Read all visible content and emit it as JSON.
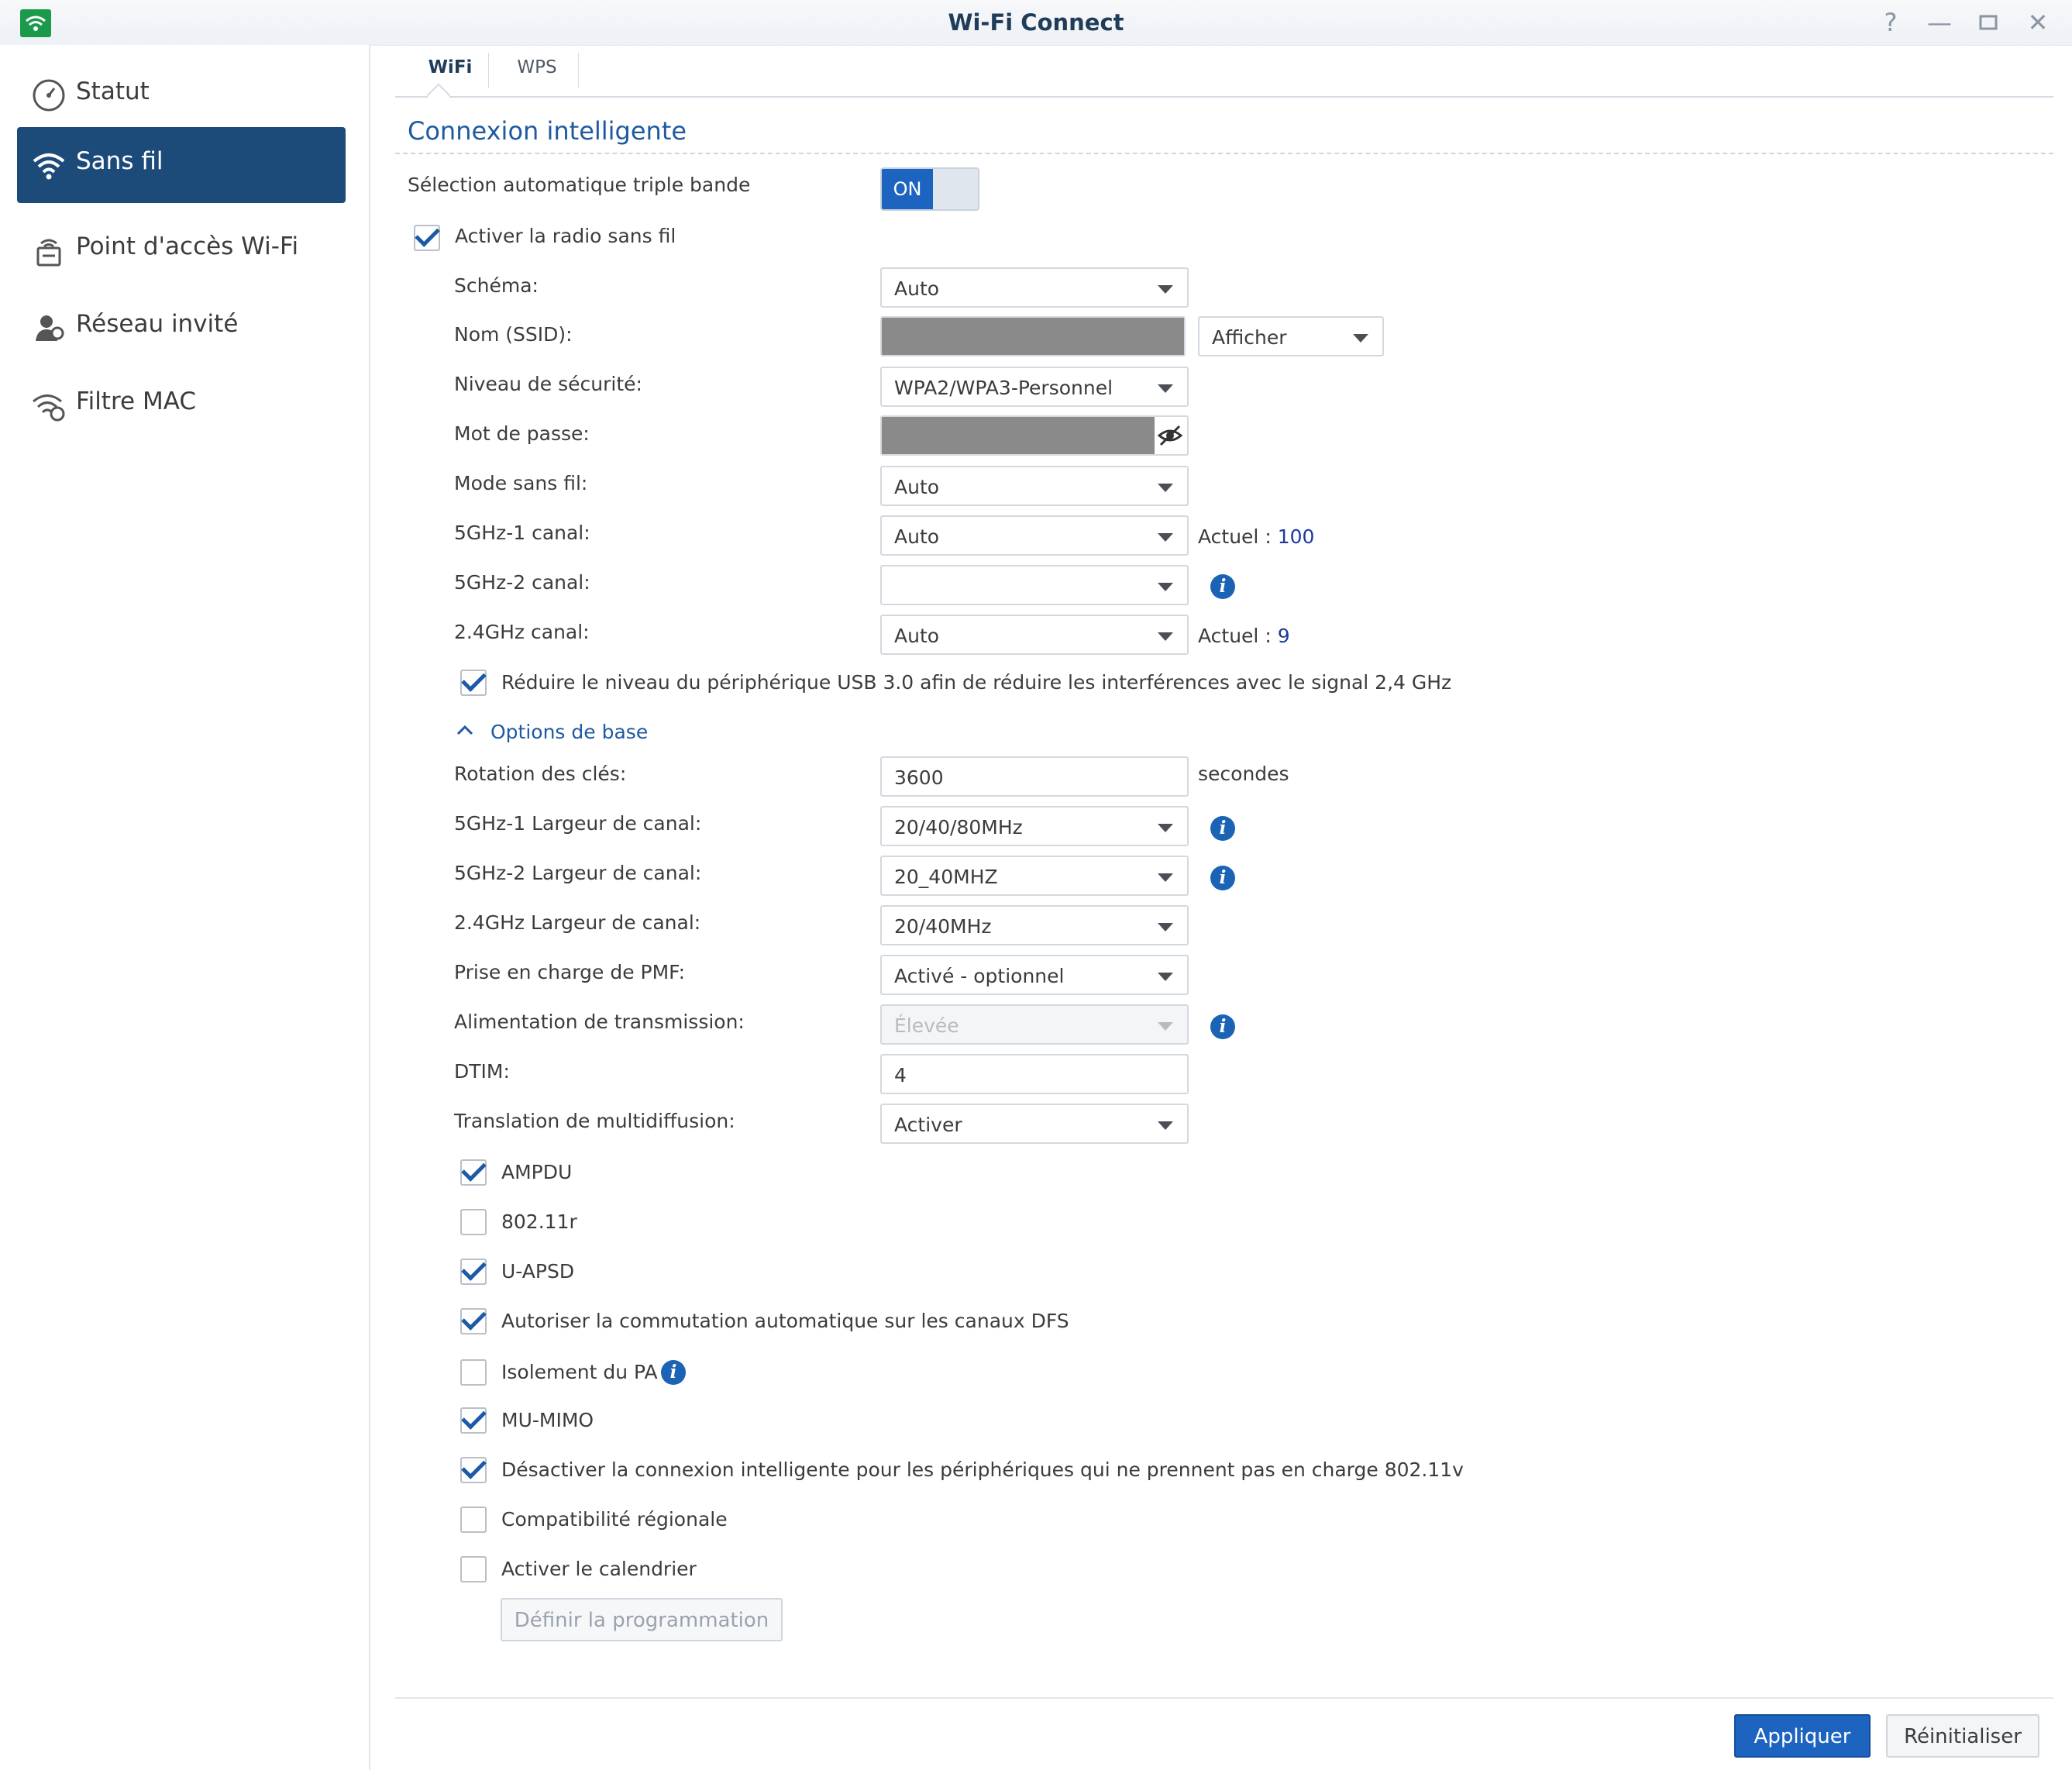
{
  "window": {
    "title": "Wi-Fi Connect"
  },
  "sidebar": {
    "items": [
      {
        "label": "Statut",
        "icon": "dashboard-gauge-icon"
      },
      {
        "label": "Sans fil",
        "icon": "wifi-icon",
        "active": true
      },
      {
        "label": "Point d'accès Wi-Fi",
        "icon": "router-icon"
      },
      {
        "label": "Réseau invité",
        "icon": "guest-user-icon"
      },
      {
        "label": "Filtre MAC",
        "icon": "wifi-filter-icon"
      }
    ]
  },
  "tabs": [
    {
      "label": "WiFi",
      "active": true
    },
    {
      "label": "WPS"
    }
  ],
  "section_title": "Connexion intelligente",
  "smart_connect": {
    "label": "Sélection automatique triple bande",
    "toggle": "ON"
  },
  "radio": {
    "label": "Activer la radio sans fil",
    "checked": true
  },
  "fields": {
    "schema": {
      "label": "Schéma:",
      "value": "Auto"
    },
    "ssid": {
      "label": "Nom (SSID):",
      "show_option": "Afficher"
    },
    "security": {
      "label": "Niveau de sécurité:",
      "value": "WPA2/WPA3-Personnel"
    },
    "password": {
      "label": "Mot de passe:"
    },
    "mode": {
      "label": "Mode sans fil:",
      "value": "Auto"
    },
    "ch5g1": {
      "label": "5GHz-1 canal:",
      "value": "Auto",
      "current_label": "Actuel :",
      "current_value": "100"
    },
    "ch5g2": {
      "label": "5GHz-2 canal:",
      "value": ""
    },
    "ch24": {
      "label": "2.4GHz canal:",
      "value": "Auto",
      "current_label": "Actuel :",
      "current_value": "9"
    }
  },
  "usb_option": {
    "label": "Réduire le niveau du périphérique USB 3.0 afin de réduire les interférences avec le signal 2,4 GHz",
    "checked": true
  },
  "basic_options": {
    "label": "Options de base"
  },
  "advanced": {
    "key_rotation": {
      "label": "Rotation des clés:",
      "value": "3600",
      "unit": "secondes"
    },
    "bw5g1": {
      "label": "5GHz-1 Largeur de canal:",
      "value": "20/40/80MHz"
    },
    "bw5g2": {
      "label": "5GHz-2 Largeur de canal:",
      "value": "20_40MHZ"
    },
    "bw24": {
      "label": "2.4GHz Largeur de canal:",
      "value": "20/40MHz"
    },
    "pmf": {
      "label": "Prise en charge de PMF:",
      "value": "Activé - optionnel"
    },
    "tx_power": {
      "label": "Alimentation de transmission:",
      "value": "Élevée"
    },
    "dtim": {
      "label": "DTIM:",
      "value": "4"
    },
    "multicast": {
      "label": "Translation de multidiffusion:",
      "value": "Activer"
    }
  },
  "checkboxes": [
    {
      "label": "AMPDU",
      "checked": true
    },
    {
      "label": "802.11r",
      "checked": false
    },
    {
      "label": "U-APSD",
      "checked": true
    },
    {
      "label": "Autoriser la commutation automatique sur les canaux DFS",
      "checked": true
    },
    {
      "label": "Isolement du PA",
      "checked": false
    },
    {
      "label": "MU-MIMO",
      "checked": true
    },
    {
      "label": "Désactiver la connexion intelligente pour les périphériques qui ne prennent pas en charge 802.11v",
      "checked": true
    },
    {
      "label": "Compatibilité régionale",
      "checked": false
    },
    {
      "label": "Activer le calendrier",
      "checked": false
    }
  ],
  "schedule_button": "Définir la programmation",
  "footer": {
    "apply": "Appliquer",
    "reset": "Réinitialiser"
  },
  "colors": {
    "accent": "#1c64c0",
    "sidebar_active": "#1c4b7a",
    "section_title": "#1f5aa0"
  }
}
